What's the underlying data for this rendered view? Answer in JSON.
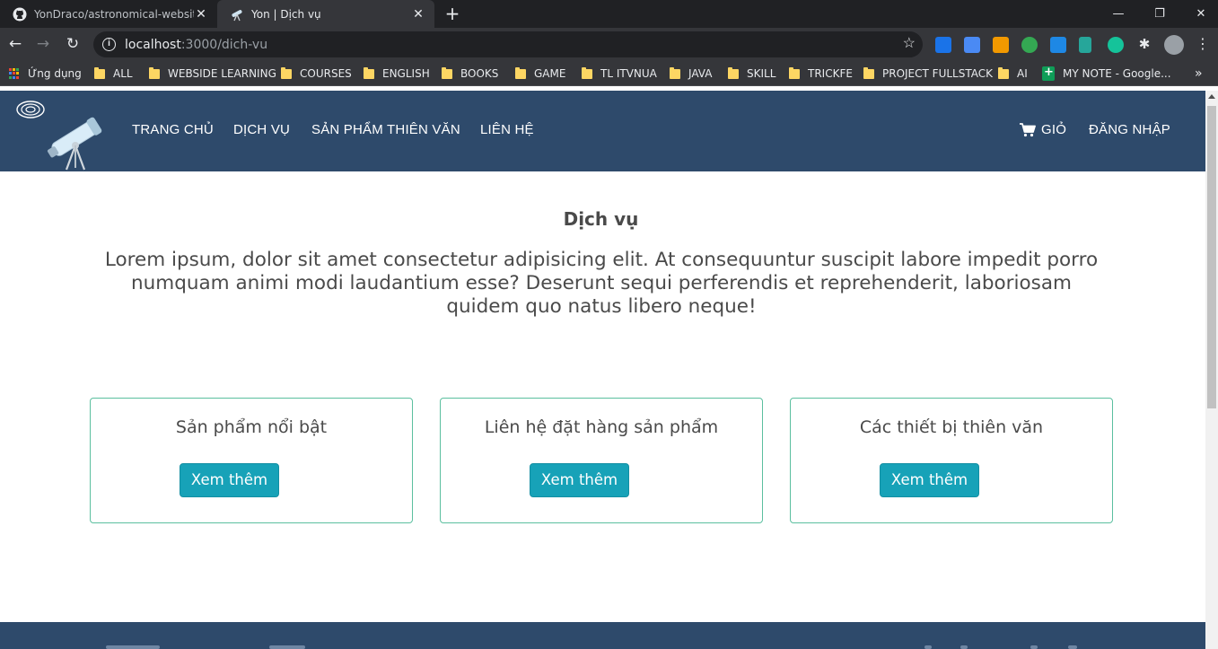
{
  "browser": {
    "tabs": [
      {
        "title": "YonDraco/astronomical-website",
        "active": false,
        "favicon": "github-icon"
      },
      {
        "title": "Yon | Dịch vụ",
        "active": true,
        "favicon": "telescope-icon"
      }
    ],
    "url": {
      "host": "localhost",
      "rest": ":3000/dich-vu"
    },
    "bookmarks": [
      {
        "label": "Ứng dụng",
        "icon": "apps-grid-icon"
      },
      {
        "label": "ALL",
        "icon": "folder-icon"
      },
      {
        "label": "WEBSIDE LEARNING",
        "icon": "folder-icon"
      },
      {
        "label": "COURSES",
        "icon": "folder-icon"
      },
      {
        "label": "ENGLISH",
        "icon": "folder-icon"
      },
      {
        "label": "BOOKS",
        "icon": "folder-icon"
      },
      {
        "label": "GAME",
        "icon": "folder-icon"
      },
      {
        "label": "TL ITVNUA",
        "icon": "folder-icon"
      },
      {
        "label": "JAVA",
        "icon": "folder-icon"
      },
      {
        "label": "SKILL",
        "icon": "folder-icon"
      },
      {
        "label": "TRICKFE",
        "icon": "folder-icon"
      },
      {
        "label": "PROJECT FULLSTACK",
        "icon": "folder-icon"
      },
      {
        "label": "AI",
        "icon": "folder-icon"
      },
      {
        "label": "MY NOTE - Google...",
        "icon": "google-sheets-icon"
      }
    ],
    "more_bookmarks": "»"
  },
  "site": {
    "nav": {
      "home": "TRANG CHỦ",
      "services": "DỊCH VỤ",
      "products": "SẢN PHẨM THIÊN VĂN",
      "contact": "LIÊN HỆ",
      "cart": "GIỎ",
      "login": "ĐĂNG NHẬP"
    },
    "section_title": "Dịch vụ",
    "lead": "Lorem ipsum, dolor sit amet consectetur adipisicing elit. At consequuntur suscipit labore impedit porro numquam animi modi laudantium esse? Deserunt sequi perferendis et reprehenderit, laboriosam quidem quo natus libero neque!",
    "cards": [
      {
        "title": "Sản phẩm nổi bật",
        "button": "Xem thêm"
      },
      {
        "title": "Liên hệ đặt hàng sản phẩm",
        "button": "Xem thêm"
      },
      {
        "title": "Các thiết bị thiên văn",
        "button": "Xem thêm"
      }
    ]
  },
  "colors": {
    "header_bg": "#2e4a6b",
    "card_border": "#5bbf9f",
    "button_bg": "#17a2b8",
    "text": "#4a4a4a"
  }
}
